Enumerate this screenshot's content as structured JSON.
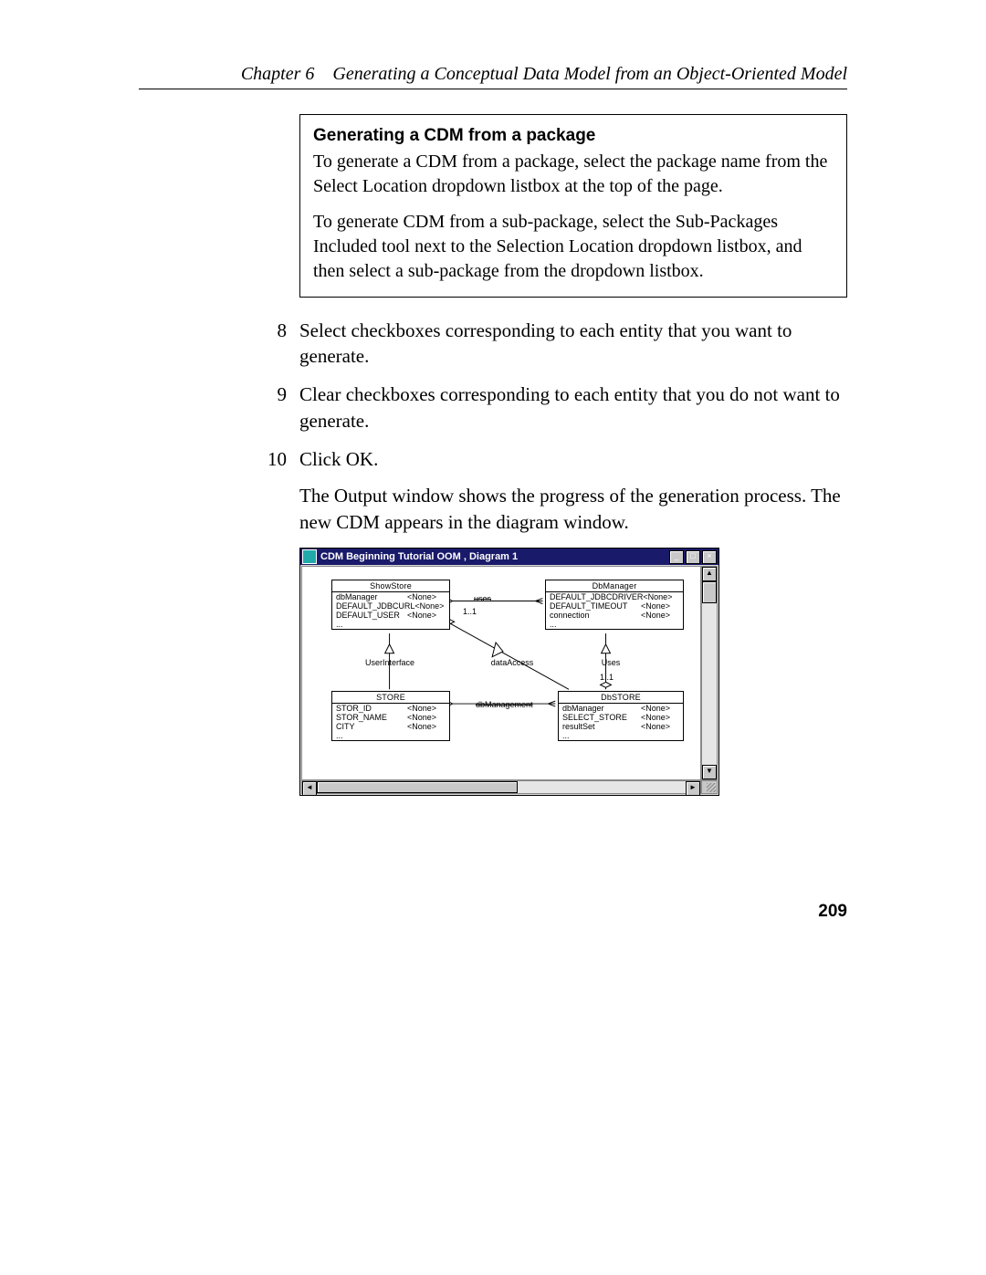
{
  "header": {
    "chapter_label": "Chapter 6",
    "chapter_title": "Generating a Conceptual Data Model from an Object-Oriented Model"
  },
  "note": {
    "title": "Generating a CDM from a package",
    "p1": "To generate a CDM from a package, select the package name from the Select Location dropdown listbox at the top of the page.",
    "p2": "To generate CDM from a sub-package, select the Sub-Packages Included tool next to the Selection Location dropdown listbox, and then select a sub-package from the dropdown listbox."
  },
  "steps": {
    "s8n": "8",
    "s8": "Select checkboxes corresponding to each entity that you want to generate.",
    "s9n": "9",
    "s9": "Clear checkboxes corresponding to each entity that you do not want to generate.",
    "s10n": "10",
    "s10a": "Click OK.",
    "s10b": "The Output window shows the progress of the generation process. The new CDM appears in the diagram window."
  },
  "window": {
    "title": "CDM Beginning Tutorial OOM , Diagram 1",
    "min": "_",
    "max": "□",
    "close": "×",
    "up": "▲",
    "down": "▼",
    "left": "◄",
    "right": "►"
  },
  "diagram": {
    "none": "<None>",
    "ellipsis": "...",
    "entities": {
      "showstore": {
        "title": "ShowStore",
        "attrs": [
          "dbManager",
          "DEFAULT_JDBCURL",
          "DEFAULT_USER"
        ]
      },
      "dbmanager": {
        "title": "DbManager",
        "attrs": [
          "DEFAULT_JDBCDRIVER",
          "DEFAULT_TIMEOUT",
          "connection"
        ]
      },
      "store": {
        "title": "STORE",
        "attrs": [
          "STOR_ID",
          "STOR_NAME",
          "CITY"
        ]
      },
      "dbstore": {
        "title": "DbSTORE",
        "attrs": [
          "dbManager",
          "SELECT_STORE",
          "resultSet"
        ]
      }
    },
    "children": {
      "ui": "UserInterface",
      "da": "dataAccess",
      "uses_right": "Uses"
    },
    "rels": {
      "uses": "uses",
      "card1": "1..1",
      "card2": "1..1",
      "dbmgmt": "dbManagement"
    }
  },
  "page_number": "209"
}
